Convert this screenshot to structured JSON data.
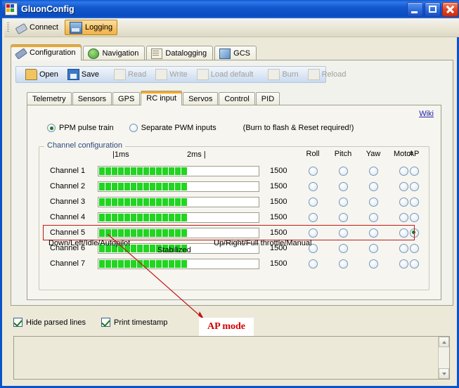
{
  "window": {
    "title": "GluonConfig",
    "icon": "app-icon",
    "buttons": {
      "minimize": "minimize",
      "maximize": "maximize",
      "close": "close"
    }
  },
  "toolbar": {
    "items": [
      {
        "label": "Connect",
        "icon": "plug-icon",
        "pressed": false
      },
      {
        "label": "Logging",
        "icon": "logging-icon",
        "pressed": true
      }
    ]
  },
  "main_tabs": [
    {
      "label": "Configuration",
      "icon": "wrench-icon",
      "active": true
    },
    {
      "label": "Navigation",
      "icon": "globe-icon",
      "active": false
    },
    {
      "label": "Datalogging",
      "icon": "document-icon",
      "active": false
    },
    {
      "label": "GCS",
      "icon": "gcs-icon",
      "active": false
    }
  ],
  "config_toolbar": [
    {
      "label": "Open",
      "icon": "folder-open-icon",
      "enabled": true
    },
    {
      "label": "Save",
      "icon": "floppy-disk-icon",
      "enabled": true
    },
    {
      "label": "Read",
      "icon": "page-read-icon",
      "enabled": false
    },
    {
      "label": "Write",
      "icon": "page-write-icon",
      "enabled": false
    },
    {
      "label": "Load default",
      "icon": "page-default-icon",
      "enabled": false
    },
    {
      "label": "Burn",
      "icon": "page-burn-icon",
      "enabled": false
    },
    {
      "label": "Reload",
      "icon": "page-reload-icon",
      "enabled": false
    }
  ],
  "sub_tabs": [
    {
      "label": "Telemetry",
      "active": false
    },
    {
      "label": "Sensors",
      "active": false
    },
    {
      "label": "GPS",
      "active": false
    },
    {
      "label": "RC input",
      "active": true
    },
    {
      "label": "Servos",
      "active": false
    },
    {
      "label": "Control",
      "active": false
    },
    {
      "label": "PID",
      "active": false
    }
  ],
  "rc_input": {
    "wiki_link": "Wiki",
    "input_mode": {
      "options": [
        {
          "label": "PPM pulse train",
          "selected": true
        },
        {
          "label": "Separate PWM inputs",
          "selected": false
        }
      ],
      "note": "(Burn to flash & Reset required!)"
    },
    "group_title": "Channel configuration",
    "scale": {
      "left_tick": "|1ms",
      "right_tick": "2ms |"
    },
    "column_headers": [
      "Roll",
      "Pitch",
      "Yaw",
      "Motor",
      "AP"
    ],
    "channels": [
      {
        "name": "Channel 1",
        "value": "1500",
        "fill_percent": 50,
        "assigned": null,
        "highlighted": false
      },
      {
        "name": "Channel 2",
        "value": "1500",
        "fill_percent": 50,
        "assigned": null,
        "highlighted": false
      },
      {
        "name": "Channel 3",
        "value": "1500",
        "fill_percent": 50,
        "assigned": null,
        "highlighted": false
      },
      {
        "name": "Channel 4",
        "value": "1500",
        "fill_percent": 50,
        "assigned": null,
        "highlighted": false
      },
      {
        "name": "Channel 5",
        "value": "1500",
        "fill_percent": 50,
        "assigned": "AP",
        "highlighted": true
      },
      {
        "name": "Channel 6",
        "value": "1500",
        "fill_percent": 50,
        "assigned": null,
        "highlighted": false
      },
      {
        "name": "Channel 7",
        "value": "1500",
        "fill_percent": 50,
        "assigned": null,
        "highlighted": false
      }
    ],
    "footer_left": "Down/Left/Idle/Autopilot",
    "footer_center": "Stabilized",
    "footer_right": "Up/Right/Full throttle/Manual"
  },
  "bottom": {
    "checkboxes": [
      {
        "label": "Hide parsed lines",
        "checked": true
      },
      {
        "label": "Print timestamp",
        "checked": true
      }
    ],
    "log_text": ""
  },
  "annotation": {
    "label": "AP mode",
    "color": "#D00000"
  },
  "colors": {
    "title_blue": "#0A54C8",
    "form_beige": "#ECE9D8",
    "panel": "#F6F5EF",
    "bar_green": "#21D521",
    "highlight_red": "#C01818",
    "link_blue": "#2222AA"
  }
}
